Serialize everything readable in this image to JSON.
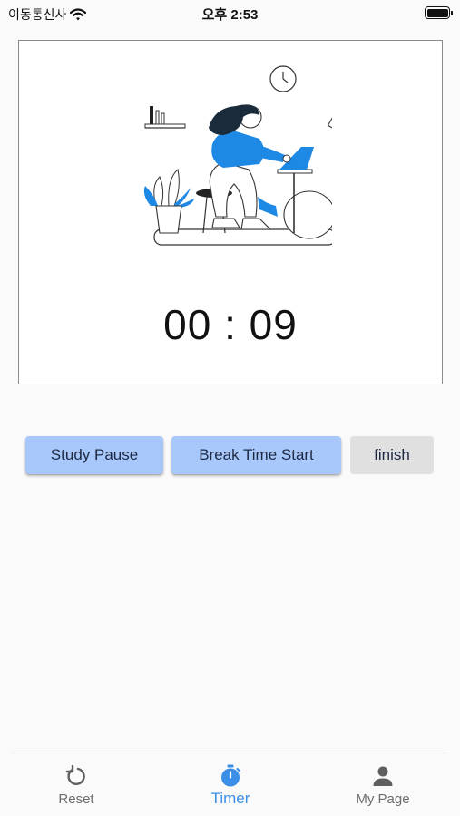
{
  "status_bar": {
    "carrier": "이동통신사",
    "time": "오후 2:53",
    "icons": [
      "wifi-icon",
      "battery-icon"
    ]
  },
  "timer": {
    "display": "00 : 09"
  },
  "buttons": {
    "study_pause": "Study Pause",
    "break_time_start": "Break Time Start",
    "finish": "finish"
  },
  "bottom_nav": {
    "items": [
      {
        "label": "Reset",
        "icon": "refresh-icon",
        "active": false
      },
      {
        "label": "Timer",
        "icon": "stopwatch-icon",
        "active": true
      },
      {
        "label": "My Page",
        "icon": "person-icon",
        "active": false
      }
    ]
  },
  "colors": {
    "accent": "#3b8fe6",
    "button_blue": "#a8c7fa",
    "button_gray": "#e0e0e0",
    "illustration_blue": "#1e88e5",
    "background": "#fafafa"
  }
}
